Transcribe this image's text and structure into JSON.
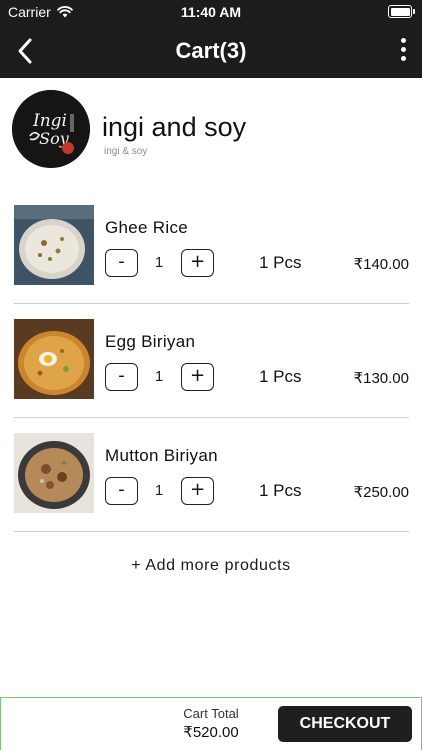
{
  "status_bar": {
    "carrier": "Carrier",
    "time": "11:40 AM"
  },
  "nav": {
    "title": "Cart(3)",
    "back_icon": "chevron-left-icon",
    "more_icon": "vertical-ellipsis-icon"
  },
  "restaurant": {
    "name": "ingi and soy",
    "subtitle": "ingi & soy",
    "logo_text_top": "Ingi",
    "logo_text_bottom": "Soy"
  },
  "items": [
    {
      "name": "Ghee Rice",
      "quantity": "1",
      "unit": "1 Pcs",
      "price": "₹140.00"
    },
    {
      "name": "Egg Biriyan",
      "quantity": "1",
      "unit": "1 Pcs",
      "price": "₹130.00"
    },
    {
      "name": "Mutton Biriyan",
      "quantity": "1",
      "unit": "1 Pcs",
      "price": "₹250.00"
    }
  ],
  "qty_controls": {
    "minus": "-",
    "plus": "+"
  },
  "add_more": "+ Add more products",
  "footer": {
    "total_label": "Cart Total",
    "total_value": "₹520.00",
    "checkout_label": "CHECKOUT"
  },
  "colors": {
    "header_bg": "#1c1c1c",
    "footer_border": "#7cc67c",
    "checkout_bg": "#1f1f1f"
  }
}
